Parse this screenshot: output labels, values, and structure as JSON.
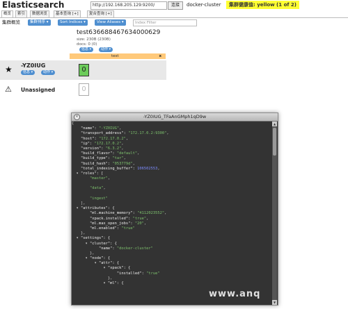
{
  "header": {
    "app_title": "Elasticsearch",
    "url_value": "http://192.168.205.129:9200/",
    "connect_label": "连接",
    "cluster_name": "docker-cluster",
    "health_label": "集群健康值: yellow (1 of 2)",
    "health_color": "#ffff33"
  },
  "tabs": [
    {
      "label": "概览"
    },
    {
      "label": "索引"
    },
    {
      "label": "数据浏览"
    },
    {
      "label": "基本查询 [+]"
    },
    {
      "label": "复合查询 [+]"
    }
  ],
  "toolbar": {
    "label": "集群概览",
    "sort_cluster": "集群排序 ▾",
    "sort_indices": "Sort Indices ▾",
    "view_aliases": "View Aliases ▾",
    "alias_filter_placeholder": "Index Filter"
  },
  "index": {
    "name": "test636688467634000629",
    "size": "size: 230B (230B)",
    "docs": "docs: 0 (0)",
    "info_label": "信息 ▾",
    "action_label": "动作 ▾",
    "alias": "test",
    "alias_close": "x"
  },
  "node": {
    "name": "-YZ0IUG",
    "info_label": "信息 ▾",
    "action_label": "动作 ▾",
    "shard": "0",
    "shard_color": "#6ccc5a"
  },
  "unassigned": {
    "label": "Unassigned",
    "shard": "0"
  },
  "dialog": {
    "title": "-YZ0IUG_TFaAnGMph1qD9w",
    "close_label": "×",
    "json_lines": [
      [
        {
          "t": "p",
          "v": "{"
        }
      ],
      [
        {
          "t": "k",
          "v": "    \"name\": "
        },
        {
          "t": "s",
          "v": "\"-YZ0IUG\""
        },
        {
          "t": "p",
          "v": ","
        }
      ],
      [
        {
          "t": "k",
          "v": "    \"transport_address\": "
        },
        {
          "t": "s",
          "v": "\"172.17.0.2:9300\""
        },
        {
          "t": "p",
          "v": ","
        }
      ],
      [
        {
          "t": "k",
          "v": "    \"host\": "
        },
        {
          "t": "s",
          "v": "\"172.17.0.2\""
        },
        {
          "t": "p",
          "v": ","
        }
      ],
      [
        {
          "t": "k",
          "v": "    \"ip\": "
        },
        {
          "t": "s",
          "v": "\"172.17.0.2\""
        },
        {
          "t": "p",
          "v": ","
        }
      ],
      [
        {
          "t": "k",
          "v": "    \"version\": "
        },
        {
          "t": "s",
          "v": "\"6.3.2\""
        },
        {
          "t": "p",
          "v": ","
        }
      ],
      [
        {
          "t": "k",
          "v": "    \"build_flavor\": "
        },
        {
          "t": "s",
          "v": "\"default\""
        },
        {
          "t": "p",
          "v": ","
        }
      ],
      [
        {
          "t": "k",
          "v": "    \"build_type\": "
        },
        {
          "t": "s",
          "v": "\"tar\""
        },
        {
          "t": "p",
          "v": ","
        }
      ],
      [
        {
          "t": "k",
          "v": "    \"build_hash\": "
        },
        {
          "t": "s",
          "v": "\"053779d\""
        },
        {
          "t": "p",
          "v": ","
        }
      ],
      [
        {
          "t": "k",
          "v": "    \"total_indexing_buffer\": "
        },
        {
          "t": "n",
          "v": "106502553"
        },
        {
          "t": "p",
          "v": ","
        }
      ],
      [
        {
          "t": "k",
          "v": "  ▾ \"roles\": ["
        }
      ],
      [
        {
          "t": "s",
          "v": "        \"master\""
        },
        {
          "t": "p",
          "v": ","
        }
      ],
      [
        {
          "t": "p",
          "v": ""
        }
      ],
      [
        {
          "t": "s",
          "v": "        \"data\""
        },
        {
          "t": "p",
          "v": ","
        }
      ],
      [
        {
          "t": "p",
          "v": ""
        }
      ],
      [
        {
          "t": "s",
          "v": "        \"ingest\""
        }
      ],
      [
        {
          "t": "p",
          "v": "    ],"
        }
      ],
      [
        {
          "t": "k",
          "v": "  ▾ \"attributes\": {"
        }
      ],
      [
        {
          "t": "k",
          "v": "        \"ml.machine_memory\": "
        },
        {
          "t": "s",
          "v": "\"4112023552\""
        },
        {
          "t": "p",
          "v": ","
        }
      ],
      [
        {
          "t": "k",
          "v": "        \"xpack.installed\": "
        },
        {
          "t": "s",
          "v": "\"true\""
        },
        {
          "t": "p",
          "v": ","
        }
      ],
      [
        {
          "t": "k",
          "v": "        \"ml.max_open_jobs\": "
        },
        {
          "t": "s",
          "v": "\"20\""
        },
        {
          "t": "p",
          "v": ","
        }
      ],
      [
        {
          "t": "k",
          "v": "        \"ml.enabled\": "
        },
        {
          "t": "s",
          "v": "\"true\""
        }
      ],
      [
        {
          "t": "p",
          "v": "    },"
        }
      ],
      [
        {
          "t": "k",
          "v": "  ▾ \"settings\": {"
        }
      ],
      [
        {
          "t": "k",
          "v": "      ▾ \"cluster\": {"
        }
      ],
      [
        {
          "t": "k",
          "v": "            \"name\": "
        },
        {
          "t": "s",
          "v": "\"docker-cluster\""
        }
      ],
      [
        {
          "t": "p",
          "v": "        },"
        }
      ],
      [
        {
          "t": "k",
          "v": "      ▾ \"node\": {"
        }
      ],
      [
        {
          "t": "k",
          "v": "          ▾ \"attr\": {"
        }
      ],
      [
        {
          "t": "k",
          "v": "              ▾ \"xpack\": {"
        }
      ],
      [
        {
          "t": "k",
          "v": "                    \"installed\": "
        },
        {
          "t": "s",
          "v": "\"true\""
        }
      ],
      [
        {
          "t": "p",
          "v": "                },"
        }
      ],
      [
        {
          "t": "k",
          "v": "              ▾ \"ml\": {"
        }
      ]
    ]
  },
  "watermark": "www.anq"
}
